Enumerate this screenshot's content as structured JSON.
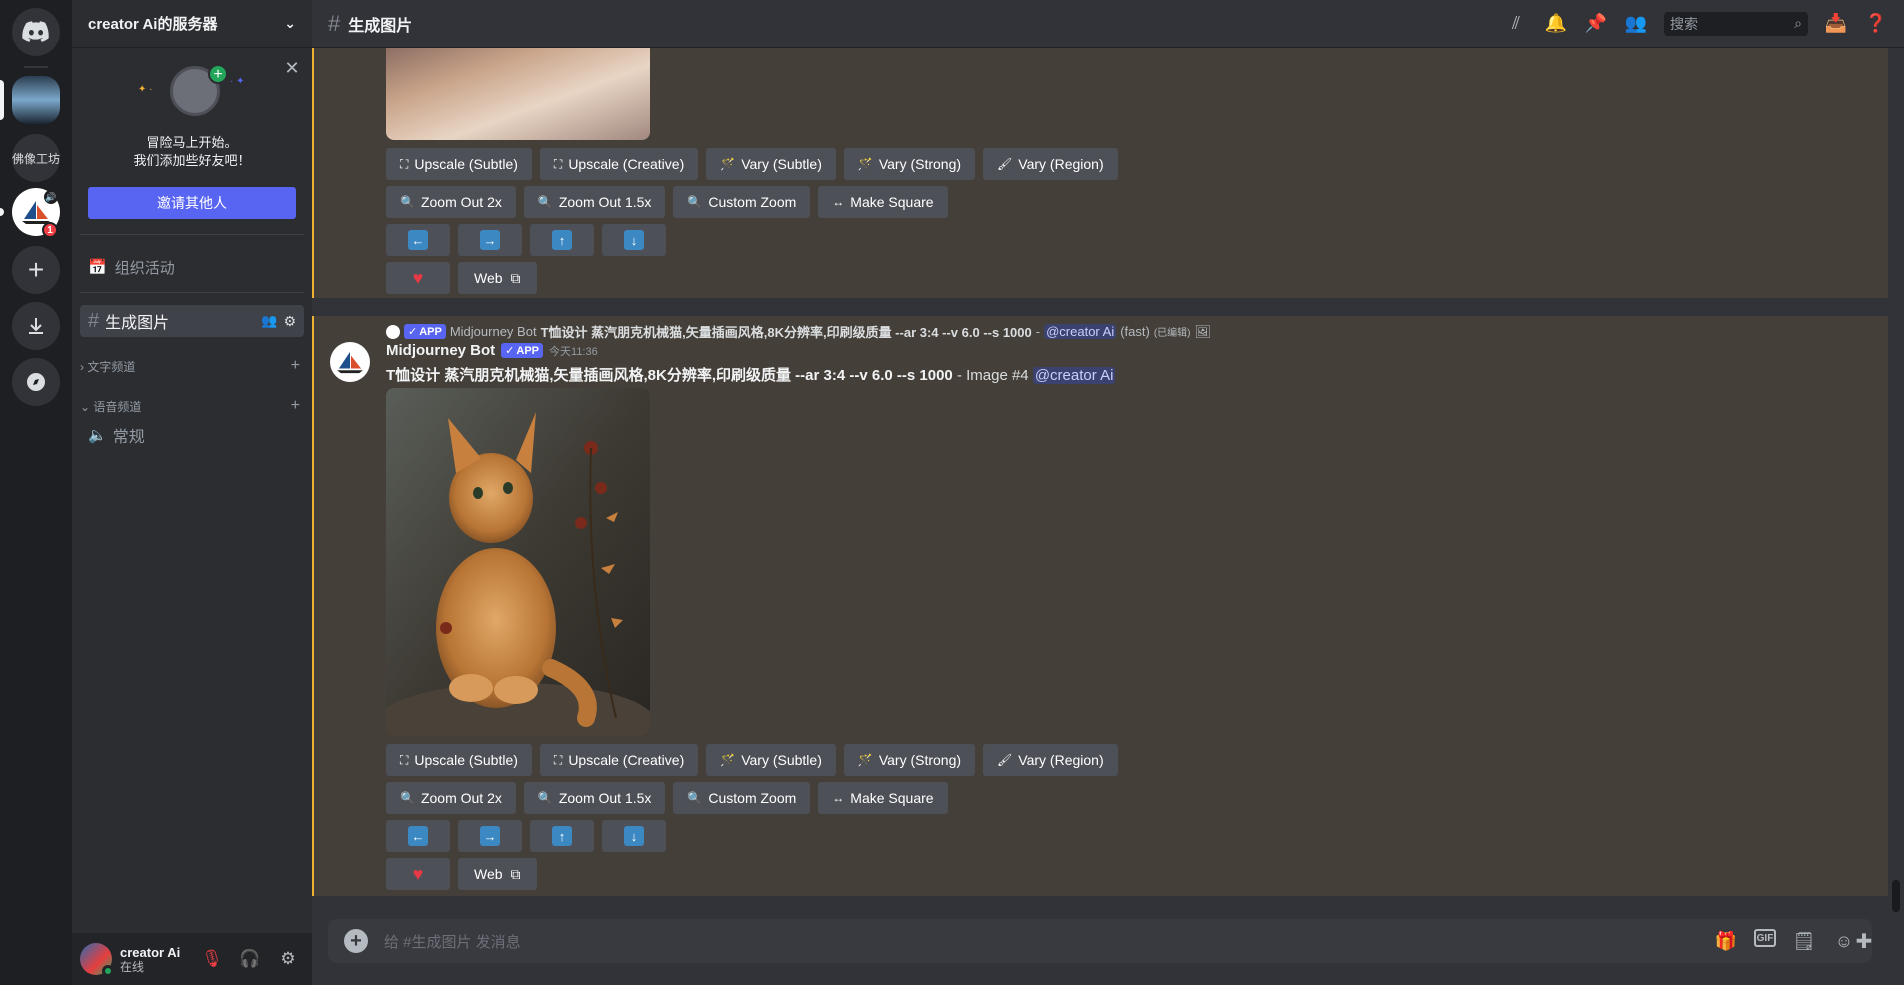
{
  "server": {
    "name": "creator Ai的服务器",
    "promo": {
      "line1": "冒险马上开始。",
      "line2": "我们添加些好友吧！",
      "invite_label": "邀请其他人"
    },
    "events_label": "组织活动",
    "active_channel": "生成图片",
    "categories": [
      {
        "label": "文字频道"
      },
      {
        "label": "语音频道"
      }
    ],
    "voice_channel": "常规"
  },
  "rail": {
    "servers": [
      {
        "label": "佛像工坊"
      },
      {
        "badge": "1"
      }
    ]
  },
  "topbar": {
    "channel": "生成图片",
    "search_placeholder": "搜索"
  },
  "buttons": {
    "upscale_subtle": "Upscale (Subtle)",
    "upscale_creative": "Upscale (Creative)",
    "vary_subtle": "Vary (Subtle)",
    "vary_strong": "Vary (Strong)",
    "vary_region": "Vary (Region)",
    "zoom_out_2x": "Zoom Out 2x",
    "zoom_out_15x": "Zoom Out 1.5x",
    "custom_zoom": "Custom Zoom",
    "make_square": "Make Square",
    "web": "Web"
  },
  "message": {
    "reply": {
      "app_tag": "APP",
      "author": "Midjourney Bot",
      "prompt": "T恤设计 蒸汽朋克机械猫,矢量插画风格,8K分辨率,印刷级质量 --ar 3:4 --v 6.0 --s 1000",
      "separator": "-",
      "mention": "@creator Ai",
      "mode": "(fast)",
      "edited": "(已编辑)"
    },
    "author": "Midjourney Bot",
    "app_tag": "APP",
    "timestamp": "今天11:36",
    "prompt": "T恤设计 蒸汽朋克机械猫,矢量插画风格,8K分辨率,印刷级质量 --ar 3:4 --v 6.0 --s 1000",
    "suffix": "- Image #4",
    "mention": "@creator Ai"
  },
  "composer": {
    "placeholder": "给 #生成图片 发消息"
  },
  "user": {
    "name": "creator Ai",
    "status": "在线"
  },
  "colors": {
    "accent": "#5865f2",
    "highlight_bg": "#443f38",
    "highlight_bar": "#f0b232",
    "online": "#23a55a"
  }
}
